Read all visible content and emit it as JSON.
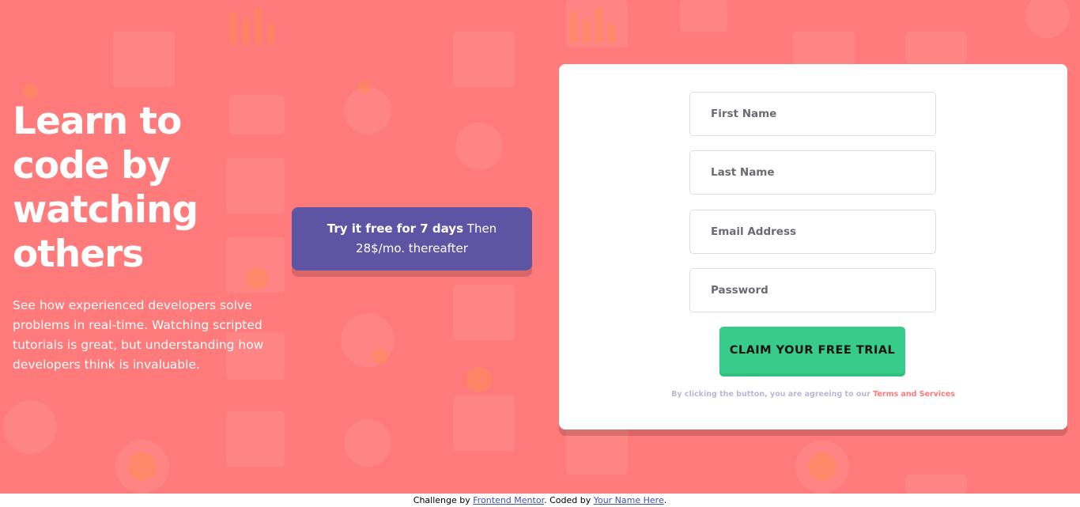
{
  "hero": {
    "headline": "Learn to code by watching others",
    "intro": "See how experienced developers solve problems in real-time. Watching scripted tutorials is great, but understanding how developers think is invaluable."
  },
  "promo": {
    "bold": "Try it free for 7 days",
    "rest": " Then 28$/mo. thereafter"
  },
  "form": {
    "first_name_placeholder": "First Name",
    "last_name_placeholder": "Last Name",
    "email_placeholder": "Email Address",
    "password_placeholder": "Password",
    "submit_label": "CLAIM YOUR FREE TRIAL",
    "terms_prefix": "By clicking the button, you are agreeing to our ",
    "terms_link": "Terms and Services"
  },
  "attribution": {
    "prefix": "Challenge by ",
    "mentor_link": "Frontend Mentor",
    "middle": ". Coded by ",
    "author_link": "Your Name Here",
    "suffix": "."
  },
  "colors": {
    "background": "#ff7a7a",
    "promo": "#5e54a4",
    "cta": "#38cc8b",
    "terms_link": "#ff7a7a"
  }
}
